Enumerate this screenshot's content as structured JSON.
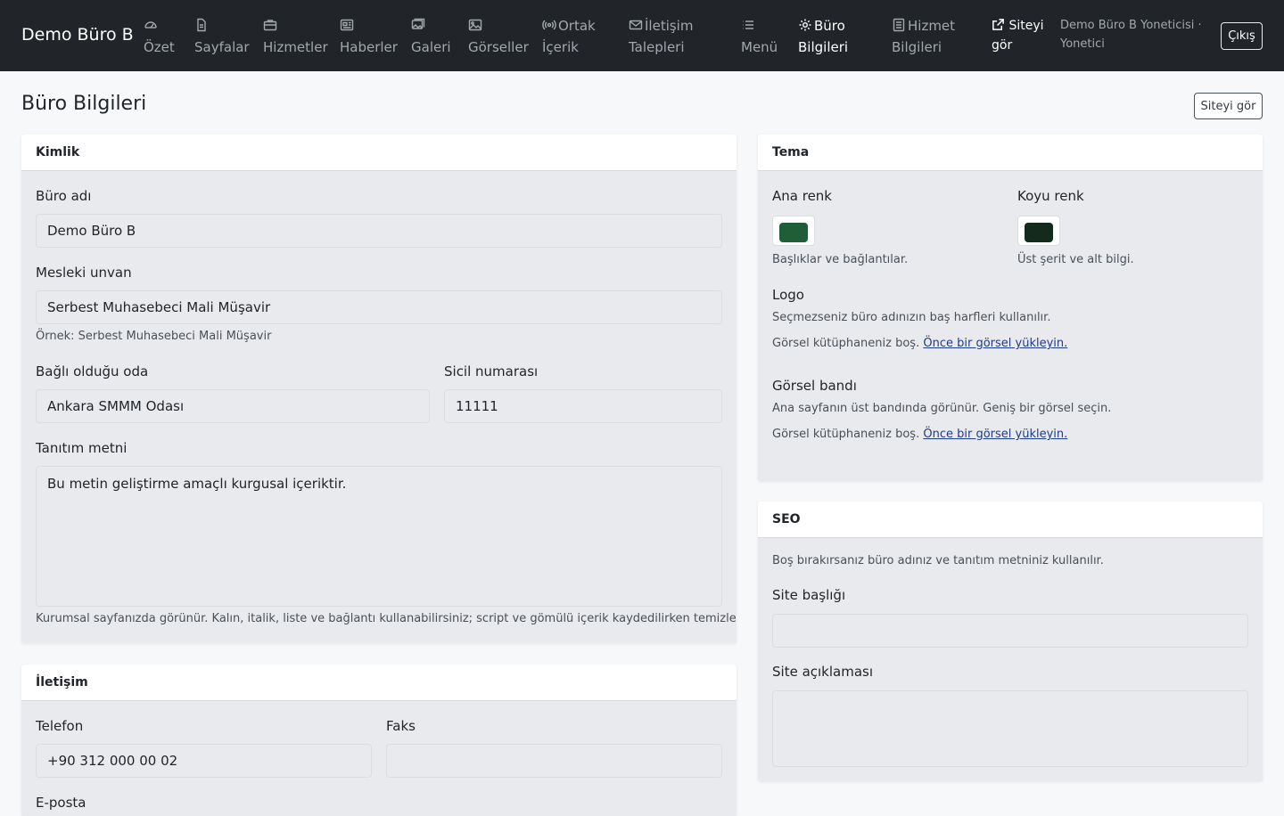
{
  "nav": {
    "brand": "Demo Büro B",
    "items": [
      {
        "label": "Özet",
        "icon": "gauge-icon"
      },
      {
        "label": "Sayfalar",
        "icon": "file-icon"
      },
      {
        "label": "Hizmetler",
        "icon": "briefcase-icon"
      },
      {
        "label": "Haberler",
        "icon": "newspaper-icon"
      },
      {
        "label": "Galeri",
        "icon": "images-icon"
      },
      {
        "label": "Görseller",
        "icon": "image-icon"
      },
      {
        "label": "Ortak İçerik",
        "label_1": "Ortak",
        "label_2": "İçerik",
        "icon": "broadcast-icon"
      },
      {
        "label": "İletişim Talepleri",
        "label_1": "İletişim",
        "label_2": "Talepleri",
        "icon": "envelope-icon"
      },
      {
        "label": "Menü",
        "icon": "list-icon"
      },
      {
        "label": "Büro Bilgileri",
        "label_1": "Büro",
        "label_2": "Bilgileri",
        "icon": "gear-icon"
      },
      {
        "label": "Hizmet Bilgileri",
        "label_1": "Hizmet",
        "label_2": "Bilgileri",
        "icon": "document-icon"
      }
    ],
    "view_site_1": "Siteyi",
    "view_site_2": "gör",
    "user_line": "Demo Büro B Yoneticisi · Yonetici",
    "logout": "Çıkış"
  },
  "page": {
    "title": "Büro Bilgileri",
    "view_site_button": "Siteyi gör"
  },
  "kimlik": {
    "header": "Kimlik",
    "office_name_label": "Büro adı",
    "office_name_value": "Demo Büro B",
    "title_label": "Mesleki unvan",
    "title_value": "Serbest Muhasebeci Mali Müşavir",
    "title_help": "Örnek: Serbest Muhasebeci Mali Müşavir",
    "chamber_label": "Bağlı olduğu oda",
    "chamber_value": "Ankara SMMM Odası",
    "registry_label": "Sicil numarası",
    "registry_value": "11111",
    "intro_label": "Tanıtım metni",
    "intro_value": "Bu metin geliştirme amaçlı kurgusal içeriktir.",
    "intro_help": "Kurumsal sayfanızda görünür. Kalın, italik, liste ve bağlantı kullanabilirsiniz; script ve gömülü içerik kaydedilirken temizlenir."
  },
  "iletisim": {
    "header": "İletişim",
    "phone_label": "Telefon",
    "phone_value": "+90 312 000 00 02",
    "fax_label": "Faks",
    "fax_value": "",
    "email_label": "E-posta"
  },
  "tema": {
    "header": "Tema",
    "primary_label": "Ana renk",
    "primary_color": "#1f5e37",
    "primary_help": "Başlıklar ve bağlantılar.",
    "dark_label": "Koyu renk",
    "dark_color": "#142a1d",
    "dark_help": "Üst şerit ve alt bilgi.",
    "logo_label": "Logo",
    "logo_help": "Seçmezseniz büro adınızın baş harfleri kullanılır.",
    "logo_empty": "Görsel kütüphaneniz boş.",
    "logo_link": "Önce bir görsel yükleyin.",
    "band_label": "Görsel bandı",
    "band_help": "Ana sayfanın üst bandında görünür. Geniş bir görsel seçin.",
    "band_empty": "Görsel kütüphaneniz boş.",
    "band_link": "Önce bir görsel yükleyin."
  },
  "seo": {
    "header": "SEO",
    "help": "Boş bırakırsanız büro adınız ve tanıtım metniniz kullanılır.",
    "site_title_label": "Site başlığı",
    "site_title_value": "",
    "site_desc_label": "Site açıklaması",
    "site_desc_value": ""
  }
}
